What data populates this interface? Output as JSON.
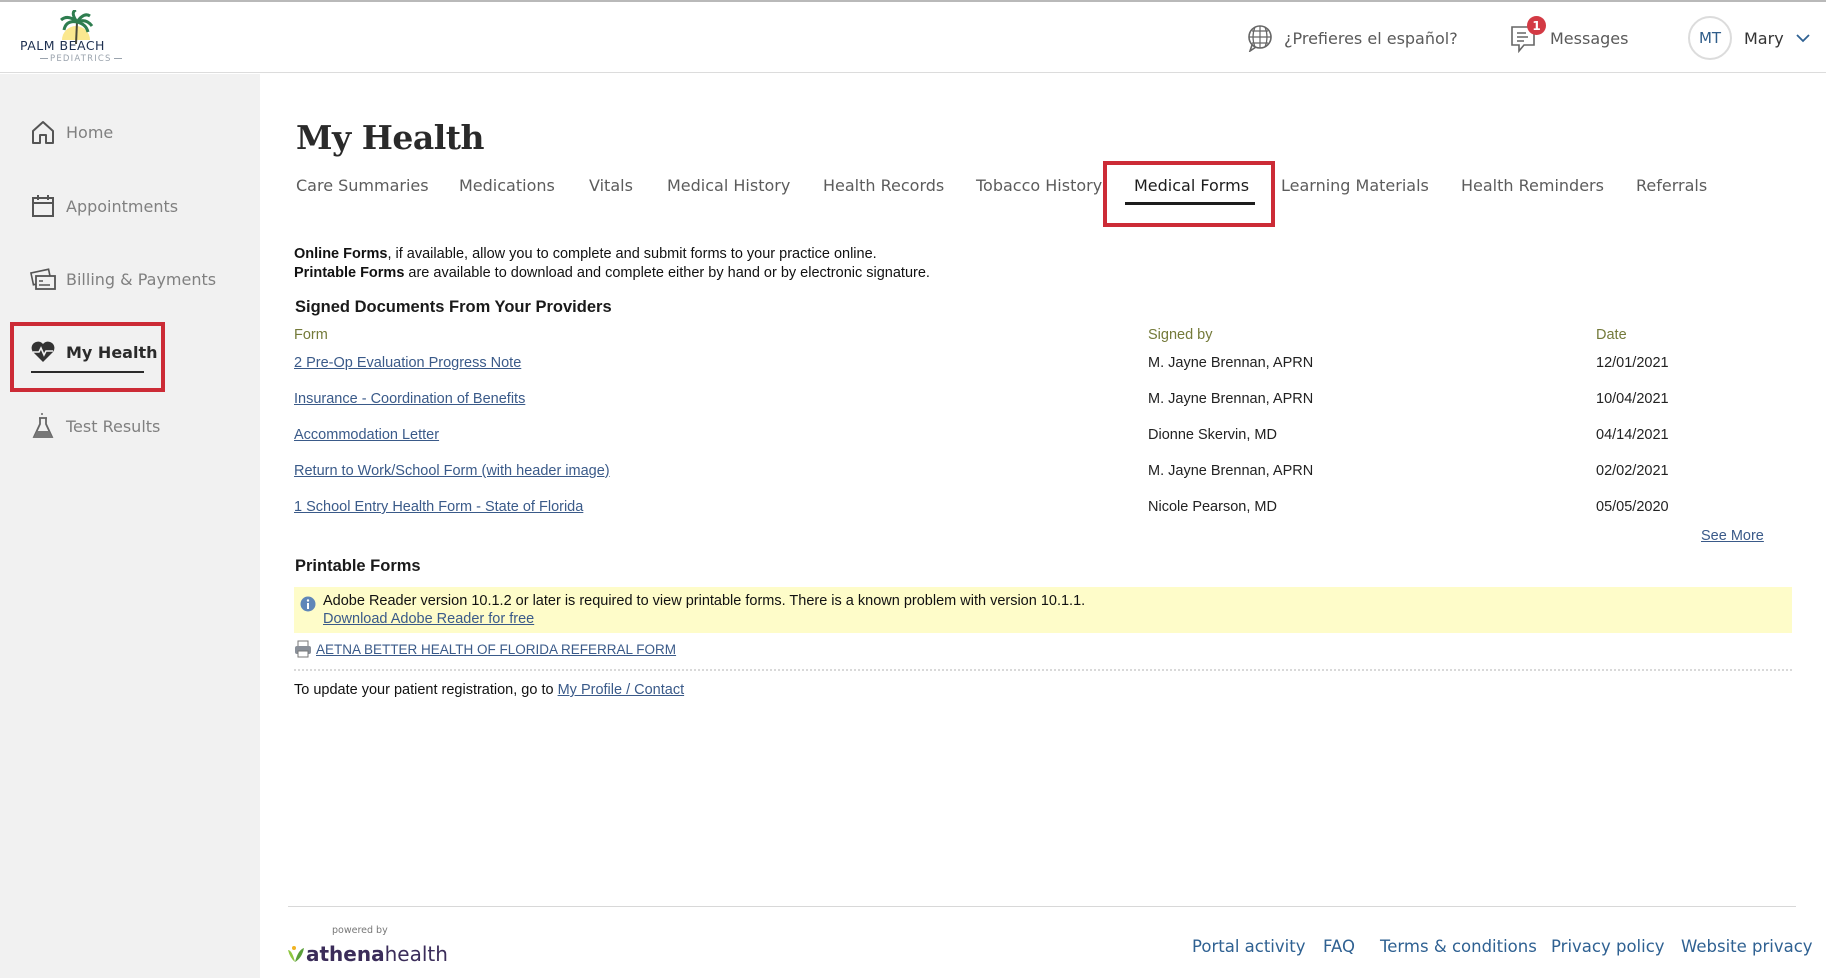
{
  "header": {
    "logo": {
      "brand": "PALM BEACH",
      "sub": "PEDIATRICS"
    },
    "language_link": "¿Prefieres el español?",
    "messages": {
      "label": "Messages",
      "badge_count": "1"
    },
    "user": {
      "initials": "MT",
      "name": "Mary"
    }
  },
  "sidebar": {
    "items": [
      {
        "label": "Home",
        "icon": "home-icon"
      },
      {
        "label": "Appointments",
        "icon": "calendar-icon"
      },
      {
        "label": "Billing & Payments",
        "icon": "credit-card-icon"
      },
      {
        "label": "My Health",
        "icon": "heart-pulse-icon",
        "active": true
      },
      {
        "label": "Test Results",
        "icon": "flask-icon"
      }
    ]
  },
  "main": {
    "title": "My Health",
    "tabs": [
      {
        "label": "Care Summaries"
      },
      {
        "label": "Medications"
      },
      {
        "label": "Vitals"
      },
      {
        "label": "Medical History"
      },
      {
        "label": "Health Records"
      },
      {
        "label": "Tobacco History"
      },
      {
        "label": "Medical Forms",
        "active": true
      },
      {
        "label": "Learning Materials"
      },
      {
        "label": "Health Reminders"
      },
      {
        "label": "Referrals"
      }
    ],
    "intro": {
      "online_bold": "Online Forms",
      "online_rest": ", if available, allow you to complete and submit forms to your practice online.",
      "printable_bold": "Printable Forms",
      "printable_rest": " are available to download and complete either by hand or by electronic signature."
    },
    "signed_documents": {
      "title": "Signed Documents From Your Providers",
      "columns": [
        "Form",
        "Signed by",
        "Date"
      ],
      "rows": [
        {
          "form": "2 Pre-Op Evaluation Progress Note",
          "signed_by": "M. Jayne Brennan, APRN",
          "date": "12/01/2021"
        },
        {
          "form": "Insurance - Coordination of Benefits",
          "signed_by": "M. Jayne Brennan, APRN",
          "date": "10/04/2021"
        },
        {
          "form": "Accommodation Letter",
          "signed_by": "Dionne Skervin, MD",
          "date": "04/14/2021"
        },
        {
          "form": "Return to Work/School Form (with header image)",
          "signed_by": "M. Jayne Brennan, APRN",
          "date": "02/02/2021"
        },
        {
          "form": "1 School Entry Health Form - State of Florida",
          "signed_by": "Nicole Pearson, MD",
          "date": "05/05/2020"
        }
      ],
      "see_more": "See More"
    },
    "printable_forms": {
      "title": "Printable Forms",
      "notice": "Adobe Reader version 10.1.2 or later is required to view printable forms. There is a known problem with version 10.1.1.",
      "notice_link": "Download Adobe Reader for free",
      "forms": [
        "AETNA BETTER HEALTH OF FLORIDA REFERRAL FORM"
      ]
    },
    "update_text": "To update your patient registration, go to ",
    "update_link": "My Profile / Contact"
  },
  "footer": {
    "powered_by": "powered by",
    "brand_bold": "athena",
    "brand_light": "health",
    "links": [
      "Portal activity",
      "FAQ",
      "Terms & conditions",
      "Privacy policy",
      "Website privacy"
    ]
  },
  "colors": {
    "highlight_border": "#cc2b36",
    "link": "#3a5a89",
    "column_header": "#747a3a",
    "notice_bg": "#fefcc9",
    "badge": "#d33a44",
    "footer_link": "#2f6192"
  }
}
